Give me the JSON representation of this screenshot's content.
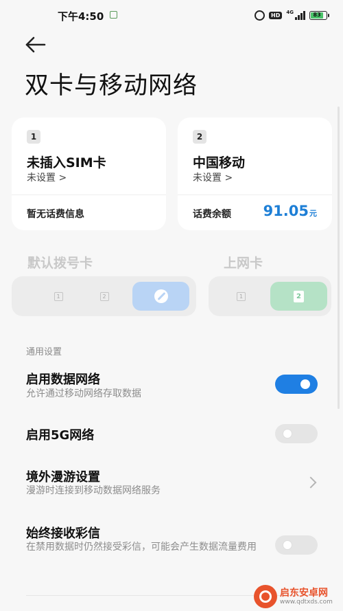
{
  "status_bar": {
    "time": "下午4:50",
    "hd": "HD",
    "network": "4G",
    "battery": "83"
  },
  "header": {
    "title": "双卡与移动网络"
  },
  "sim_cards": [
    {
      "badge": "1",
      "name": "未插入SIM卡",
      "status": "未设置 >",
      "info": "暂无话费信息"
    },
    {
      "badge": "2",
      "name": "中国移动",
      "status": "未设置 >",
      "info": "话费余额",
      "balance": "91.05",
      "balance_unit": "元"
    }
  ],
  "default_dial": {
    "label": "默认拨号卡",
    "options": [
      "1",
      "2"
    ]
  },
  "data_card": {
    "label": "上网卡",
    "options": [
      "1",
      "2"
    ]
  },
  "settings": {
    "section_label": "通用设置",
    "items": [
      {
        "title": "启用数据网络",
        "desc": "允许通过移动网络存取数据",
        "toggle": true
      },
      {
        "title": "启用5G网络",
        "toggle": false
      },
      {
        "title": "境外漫游设置",
        "desc": "漫游时连接到移动数据网络服务"
      },
      {
        "title": "始终接收彩信",
        "desc": "在禁用数据时仍然接受彩信，可能会产生数据流量费用",
        "toggle": false
      }
    ]
  },
  "watermark": {
    "name": "启东安卓网",
    "url": "www.qdtxds.com"
  },
  "colors": {
    "accent": "#1f7fe3",
    "balance": "#1e7fd6",
    "dial_active": "#b9d4f5",
    "data_active": "#b5e2c6"
  }
}
